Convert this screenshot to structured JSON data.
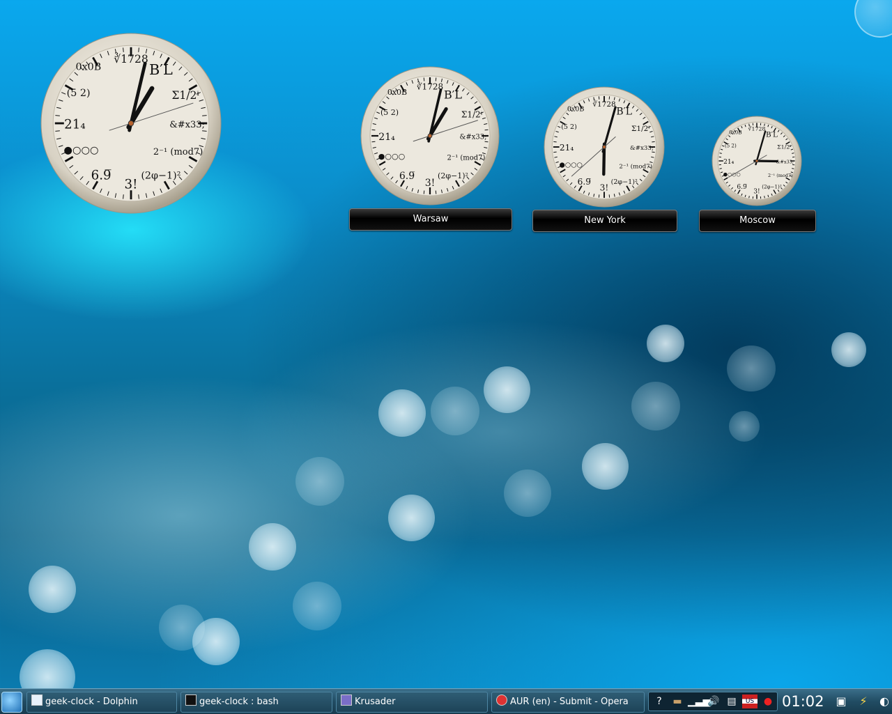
{
  "desktop": {
    "clocks": [
      {
        "label": "",
        "hour": 1,
        "minute": 2,
        "second": 12
      },
      {
        "label": "Warsaw",
        "hour": 1,
        "minute": 2,
        "second": 12
      },
      {
        "label": "New York",
        "hour": 6,
        "minute": 2,
        "second": 38
      },
      {
        "label": "Moscow",
        "hour": 3,
        "minute": 2,
        "second": 40
      }
    ],
    "face_labels": {
      "t0": "0x0B",
      "t1": "∛1728",
      "t2": "B′L",
      "t3": "Σ1/2ⁱ",
      "t4": "&#x33;",
      "t5": "2⁻¹ (mod7)",
      "t6": "(2φ−1)²",
      "t7": "3!",
      "t8": "6.9̅",
      "t9": "●○○○",
      "t10": "21₄",
      "t11": "(5 2)"
    }
  },
  "taskbar": {
    "tasks": [
      {
        "label": "geek-clock - Dolphin",
        "icon": "dolphin-icon"
      },
      {
        "label": "geek-clock : bash",
        "icon": "terminal-icon"
      },
      {
        "label": "Krusader",
        "icon": "krusader-icon"
      },
      {
        "label": "AUR (en) - Submit - Opera",
        "icon": "opera-icon"
      }
    ],
    "tray_icons": [
      "help-icon",
      "wallet-icon",
      "network-signal-icon",
      "volume-icon",
      "clipboard-icon",
      "keyboard-layout-us-icon",
      "pacman-ghost-icon"
    ],
    "keyboard_layout": "US",
    "clock": "01:02"
  }
}
